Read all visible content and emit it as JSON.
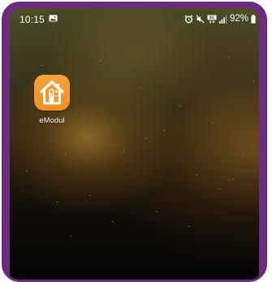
{
  "status_bar": {
    "time": "10:15",
    "battery_percent": "92%",
    "icons": [
      "gallery-icon",
      "alarm-icon",
      "mute-icon",
      "data-icon",
      "signal-icon",
      "battery-icon"
    ]
  },
  "home_screen": {
    "apps": [
      {
        "label": "eModul",
        "icon": "house-thermometer-icon",
        "color": "#f2992c"
      }
    ]
  },
  "colors": {
    "frame": "#6b2c7e",
    "wallpaper_glow": "#d79b37"
  }
}
